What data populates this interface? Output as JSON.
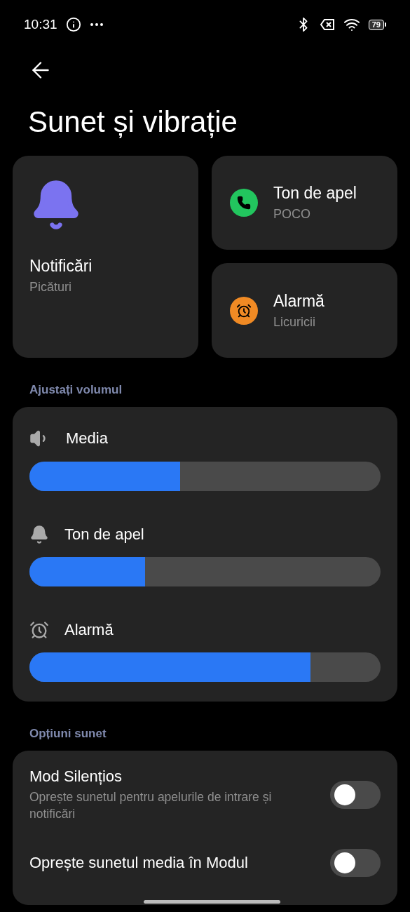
{
  "status_bar": {
    "time": "10:31",
    "battery": "79"
  },
  "title": "Sunet și vibrație",
  "tiles": [
    {
      "kind": "notifications",
      "title": "Notificări",
      "subtitle": "Picături"
    },
    {
      "kind": "ringtone",
      "title": "Ton de apel",
      "subtitle": "POCO"
    },
    {
      "kind": "alarm",
      "title": "Alarmă",
      "subtitle": "Licuricii"
    }
  ],
  "volume_section": {
    "label": "Ajustați volumul",
    "sliders": [
      {
        "kind": "media",
        "label": "Media",
        "level": 0.43
      },
      {
        "kind": "ringtone",
        "label": "Ton de apel",
        "level": 0.33
      },
      {
        "kind": "alarm",
        "label": "Alarmă",
        "level": 0.8
      }
    ]
  },
  "options_section": {
    "label": "Opțiuni sunet",
    "items": [
      {
        "title": "Mod Silențios",
        "description": "Oprește sunetul pentru apelurile de intrare și notificări",
        "on": false
      },
      {
        "title": "Oprește sunetul media în Modul",
        "on": false
      }
    ]
  }
}
